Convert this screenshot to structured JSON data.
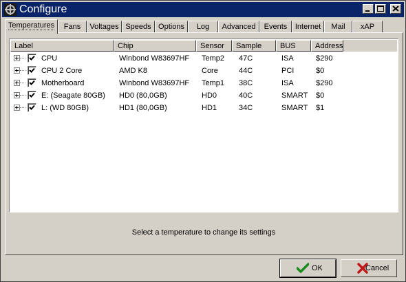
{
  "window": {
    "title": "Configure"
  },
  "tabs": [
    "Temperatures",
    "Fans",
    "Voltages",
    "Speeds",
    "Options",
    "Log",
    "Advanced",
    "Events",
    "Internet",
    "Mail",
    "xAP"
  ],
  "table": {
    "headers": [
      "Label",
      "Chip",
      "Sensor",
      "Sample",
      "BUS",
      "Address"
    ],
    "rows": [
      {
        "label": "CPU",
        "chip": "Winbond W83697HF",
        "sensor": "Temp2",
        "sample": "47C",
        "bus": "ISA",
        "address": "$290",
        "checked": true
      },
      {
        "label": "CPU 2 Core",
        "chip": "AMD K8",
        "sensor": "Core",
        "sample": "44C",
        "bus": "PCI",
        "address": "$0",
        "checked": true
      },
      {
        "label": "Motherboard",
        "chip": "Winbond W83697HF",
        "sensor": "Temp1",
        "sample": "38C",
        "bus": "ISA",
        "address": "$290",
        "checked": true
      },
      {
        "label": "E: (Seagate 80GB)",
        "chip": "HD0 (80,0GB)",
        "sensor": "HD0",
        "sample": "40C",
        "bus": "SMART",
        "address": "$0",
        "checked": true
      },
      {
        "label": "L: (WD 80GB)",
        "chip": "HD1 (80,0GB)",
        "sensor": "HD1",
        "sample": "34C",
        "bus": "SMART",
        "address": "$1",
        "checked": true
      }
    ]
  },
  "status_text": "Select a temperature to change its settings",
  "buttons": {
    "ok": "OK",
    "cancel": "Cancel"
  },
  "colors": {
    "title_bar": "#0a246a",
    "ok_check": "#1a8a1a",
    "cancel_x": "#c01818"
  }
}
